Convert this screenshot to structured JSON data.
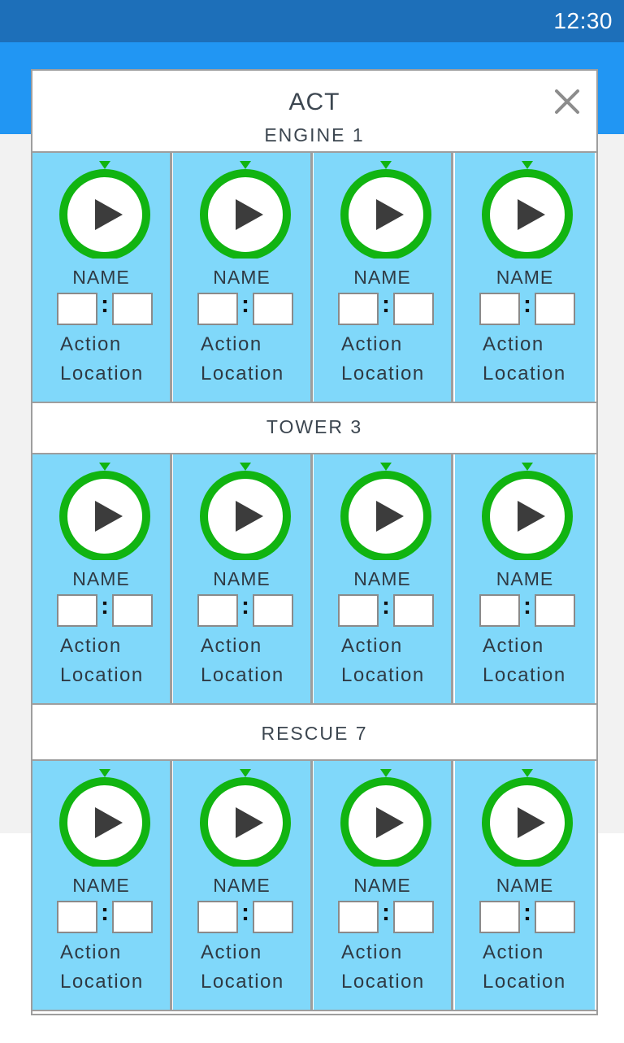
{
  "status_bar": {
    "time": "12:30"
  },
  "dialog": {
    "title": "ACT",
    "close_icon": "close-icon",
    "colors": {
      "card_bg": "#80d8fa",
      "timer_ring": "#11b411",
      "play_icon": "#3c3c3c",
      "app_bar": "#2196f3",
      "status_bar": "#1d6fb9"
    },
    "sections": [
      {
        "label": "ENGINE 1",
        "units": [
          {
            "name": "NAME",
            "hours": "",
            "minutes": "",
            "action": "Action",
            "location": "Location"
          },
          {
            "name": "NAME",
            "hours": "",
            "minutes": "",
            "action": "Action",
            "location": "Location"
          },
          {
            "name": "NAME",
            "hours": "",
            "minutes": "",
            "action": "Action",
            "location": "Location"
          },
          {
            "name": "NAME",
            "hours": "",
            "minutes": "",
            "action": "Action",
            "location": "Location"
          }
        ]
      },
      {
        "label": "TOWER 3",
        "units": [
          {
            "name": "NAME",
            "hours": "",
            "minutes": "",
            "action": "Action",
            "location": "Location"
          },
          {
            "name": "NAME",
            "hours": "",
            "minutes": "",
            "action": "Action",
            "location": "Location"
          },
          {
            "name": "NAME",
            "hours": "",
            "minutes": "",
            "action": "Action",
            "location": "Location"
          },
          {
            "name": "NAME",
            "hours": "",
            "minutes": "",
            "action": "Action",
            "location": "Location"
          }
        ]
      },
      {
        "label": "RESCUE 7",
        "units": [
          {
            "name": "NAME",
            "hours": "",
            "minutes": "",
            "action": "Action",
            "location": "Location"
          },
          {
            "name": "NAME",
            "hours": "",
            "minutes": "",
            "action": "Action",
            "location": "Location"
          },
          {
            "name": "NAME",
            "hours": "",
            "minutes": "",
            "action": "Action",
            "location": "Location"
          },
          {
            "name": "NAME",
            "hours": "",
            "minutes": "",
            "action": "Action",
            "location": "Location"
          }
        ]
      }
    ],
    "timer_icon": "play-timer-icon",
    "time_separator": ":"
  }
}
